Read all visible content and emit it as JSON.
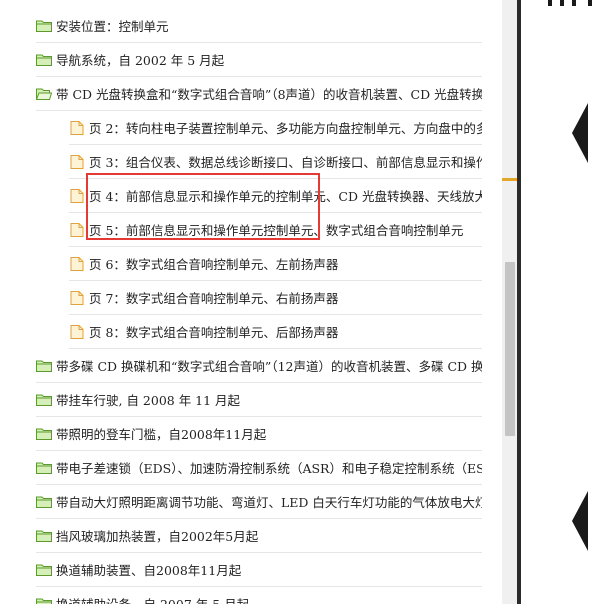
{
  "tree": {
    "items": [
      {
        "type": "folder",
        "state": "closed",
        "label": "安装位置：控制单元"
      },
      {
        "type": "folder",
        "state": "closed",
        "label": "导航系统，自 2002 年 5 月起"
      },
      {
        "type": "folder",
        "state": "open",
        "label": "带 CD 光盘转换盒和“数字式组合音响”（8声道）的收音机装置、CD 光盘转换盒"
      },
      {
        "type": "page",
        "label": "页 2：转向柱电子装置控制单元、多功能方向盘控制单元、方向盘中的多"
      },
      {
        "type": "page",
        "label": "页 3：组合仪表、数据总线诊断接口、自诊断接口、前部信息显示和操作"
      },
      {
        "type": "page",
        "label": "页 4：前部信息显示和操作单元的控制单元、CD 光盘转换器、天线放大器"
      },
      {
        "type": "page",
        "label": "页 5：前部信息显示和操作单元控制单元、数字式组合音响控制单元"
      },
      {
        "type": "page",
        "label": "页 6：数字式组合音响控制单元、左前扬声器"
      },
      {
        "type": "page",
        "label": "页 7：数字式组合音响控制单元、右前扬声器"
      },
      {
        "type": "page",
        "label": "页 8：数字式组合音响控制单元、后部扬声器"
      },
      {
        "type": "folder",
        "state": "closed",
        "label": "带多碟 CD 换碟机和“数字式组合音响”（12声道）的收音机装置、多碟 CD 换碟"
      },
      {
        "type": "folder",
        "state": "closed",
        "label": "带挂车行驶, 自 2008 年 11 月起"
      },
      {
        "type": "folder",
        "state": "closed",
        "label": "带照明的登车门槛，自2008年11月起"
      },
      {
        "type": "folder",
        "state": "closed",
        "label": "带电子差速锁（EDS）、加速防滑控制系统（ASR）和电子稳定控制系统（ESP"
      },
      {
        "type": "folder",
        "state": "closed",
        "label": "带自动大灯照明距离调节功能、弯道灯、LED 白天行车灯功能的气体放电大灯"
      },
      {
        "type": "folder",
        "state": "closed",
        "label": "挡风玻璃加热装置，自2002年5月起"
      },
      {
        "type": "folder",
        "state": "closed",
        "label": "换道辅助装置、自2008年11月起"
      },
      {
        "type": "folder",
        "state": "closed",
        "label": "换道辅助设备，自 2007 年 5 月起"
      }
    ]
  },
  "colors": {
    "folder_fill": "#d6efb8",
    "folder_stroke": "#5c9a2e",
    "page_fill": "#fff3d6",
    "page_stroke": "#e0a23a",
    "highlight_border": "#e53935",
    "nav_arrow": "#1a1a1a",
    "divider": "#2b2b2b",
    "marker": "#e2a729"
  },
  "icons": {
    "folder_closed": "folder-icon",
    "folder_open": "folder-open-icon",
    "page": "page-icon",
    "nav_prev": "nav-prev-arrow-icon",
    "nav_next": "nav-next-arrow-icon"
  }
}
